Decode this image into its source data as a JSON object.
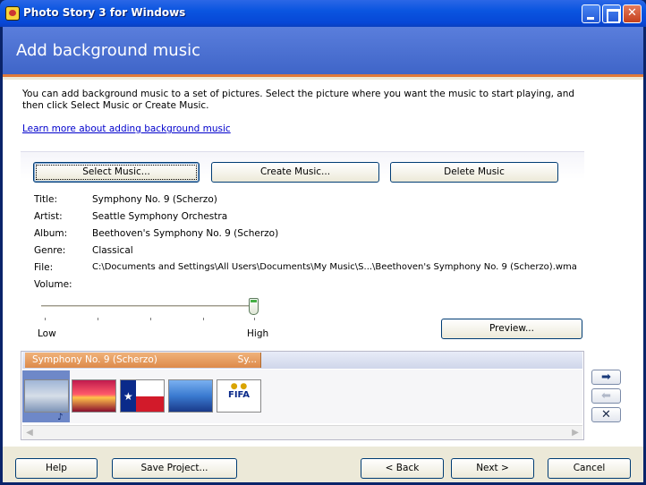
{
  "window": {
    "title": "Photo Story 3 for Windows"
  },
  "header": {
    "title": "Add background music"
  },
  "intro": {
    "text": "You can add background music to a set of pictures.  Select the picture where you want the music to start playing, and then click Select Music or Create Music.",
    "link": "Learn more about adding background music"
  },
  "music_buttons": {
    "select": "Select Music...",
    "create": "Create Music...",
    "delete": "Delete Music"
  },
  "track_info": {
    "title_label": "Title:",
    "title_value": "Symphony No. 9 (Scherzo)",
    "artist_label": "Artist:",
    "artist_value": "Seattle Symphony Orchestra",
    "album_label": "Album:",
    "album_value": "Beethoven's Symphony No. 9 (Scherzo)",
    "genre_label": "Genre:",
    "genre_value": "Classical",
    "file_label": "File:",
    "file_value": "C:\\Documents and Settings\\All Users\\Documents\\My Music\\S...\\Beethoven's Symphony No. 9 (Scherzo).wma"
  },
  "volume": {
    "label": "Volume:",
    "low": "Low",
    "high": "High",
    "level": 1.0
  },
  "preview_label": "Preview...",
  "timeline": {
    "music_label": "Symphony No. 9 (Scherzo)",
    "music_tail": "Sy...",
    "thumbnails": [
      "cloudy-sky",
      "red-sunset",
      "texas-flag",
      "blue-mountains",
      "fifa-logo"
    ],
    "fifa_text": "FIFA"
  },
  "side_buttons": {
    "forward": "forward-arrow-icon",
    "back": "back-arrow-icon",
    "remove": "remove-icon"
  },
  "footer": {
    "help": "Help",
    "save": "Save Project...",
    "back": "< Back",
    "next": "Next >",
    "cancel": "Cancel"
  }
}
